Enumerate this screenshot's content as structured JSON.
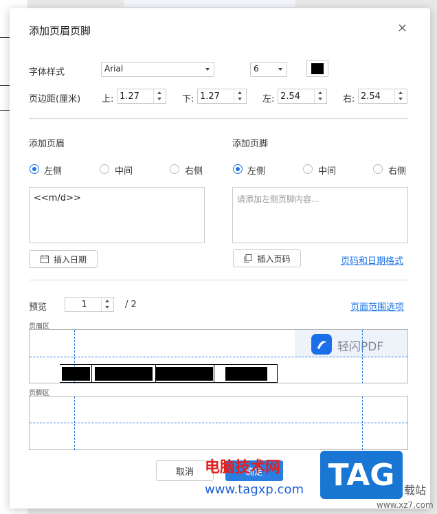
{
  "dialog": {
    "title": "添加页眉页脚"
  },
  "font": {
    "label": "字体样式",
    "family": "Arial",
    "size": "6",
    "color": "#000000"
  },
  "margins": {
    "label": "页边距(厘米)",
    "top_label": "上:",
    "top_value": "1.27",
    "bottom_label": "下:",
    "bottom_value": "1.27",
    "left_label": "左:",
    "left_value": "2.54",
    "right_label": "右:",
    "right_value": "2.54"
  },
  "header": {
    "title": "添加页眉",
    "options": [
      "左侧",
      "中间",
      "右侧"
    ],
    "selected": "左侧",
    "content": "<<m/d>>",
    "insert_button": "插入日期"
  },
  "footer": {
    "title": "添加页脚",
    "options": [
      "左侧",
      "中间",
      "右侧"
    ],
    "selected": "左侧",
    "placeholder": "请添加左侧页脚内容...",
    "insert_button": "插入页码",
    "format_link": "页码和日期格式"
  },
  "preview": {
    "label": "预览",
    "page": "1",
    "total": "/ 2",
    "range_link": "页面范围选项",
    "header_zone": "页眉区",
    "footer_zone": "页脚区",
    "logo_text": "轻闪PDF"
  },
  "actions": {
    "cancel": "取消",
    "ok": "确定"
  },
  "watermark": {
    "site_name": "电脑技术网",
    "site_url": "www.tagxp.com",
    "tag": "TAG",
    "corner": "载站",
    "corner_url": "www.xz7.com"
  },
  "colors": {
    "accent": "#1a73e8",
    "dashed": "#2a7de1"
  }
}
